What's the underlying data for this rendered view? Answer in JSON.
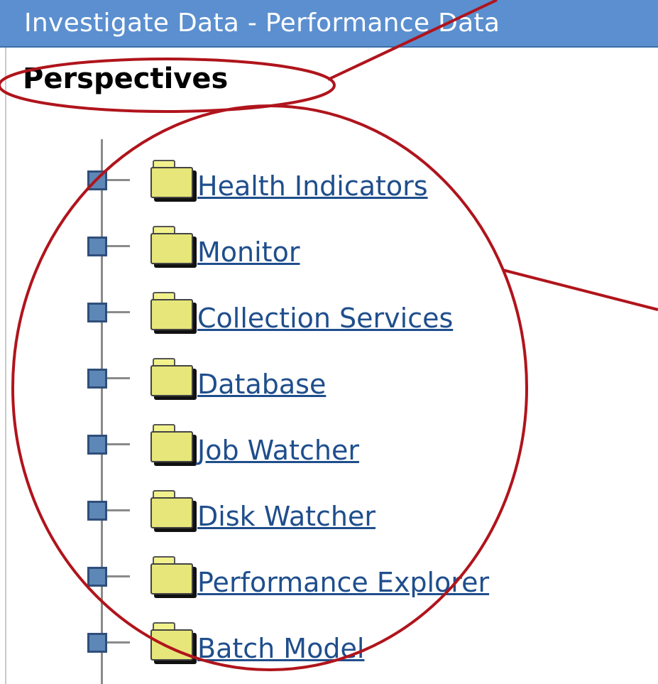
{
  "window": {
    "title": "Investigate Data - Performance Data"
  },
  "panel": {
    "heading": "Perspectives"
  },
  "tree": {
    "items": [
      {
        "label": "Health Indicators"
      },
      {
        "label": "Monitor"
      },
      {
        "label": "Collection Services"
      },
      {
        "label": "Database"
      },
      {
        "label": "Job Watcher"
      },
      {
        "label": "Disk Watcher"
      },
      {
        "label": "Performance Explorer"
      },
      {
        "label": "Batch Model"
      }
    ]
  },
  "annotation": {
    "color": "#b0141c"
  },
  "icons": {
    "expander": "collapse-square-icon",
    "folder": "folder-icon"
  }
}
